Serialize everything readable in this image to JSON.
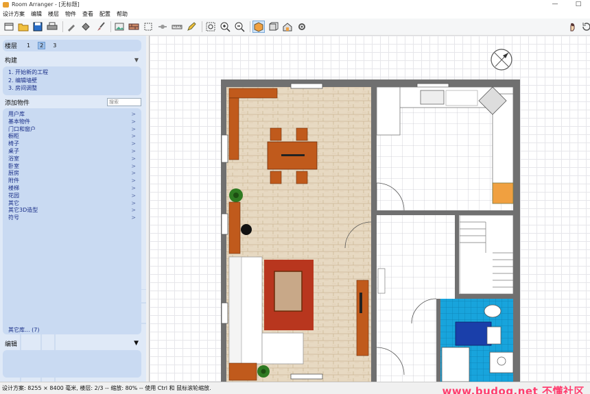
{
  "window": {
    "title": "Room Arranger - [无标题]",
    "minimize": "—",
    "maximize": "□"
  },
  "menu": [
    "设计方案",
    "编辑",
    "楼层",
    "物件",
    "查看",
    "配置",
    "帮助"
  ],
  "toolbar": {
    "icons": [
      "new-file-icon",
      "open-folder-icon",
      "save-icon",
      "print-icon",
      "pick-icon",
      "bucket-icon",
      "brush-icon",
      "import-image-icon",
      "brick-wall-icon",
      "measure-icon",
      "dimension-icon",
      "ruler-icon",
      "pencil-icon",
      "zoom-fit-icon",
      "zoom-in-icon",
      "zoom-out-icon",
      "view-2d-icon",
      "view-3d-box-icon",
      "view-3d-house-icon",
      "settings-icon",
      "hand-icon",
      "rotate-icon"
    ]
  },
  "floors": {
    "label": "楼层",
    "items": [
      "1",
      "2",
      "3"
    ],
    "selected": "2"
  },
  "build": {
    "title": "构建",
    "steps": [
      "1.  开始新的工程",
      "2.  编辑墙壁",
      "3.  房间调整"
    ]
  },
  "add_objects": {
    "title": "添加物件",
    "search_placeholder": "搜索",
    "categories": [
      "用户库",
      "基本物件",
      "门口和窗户",
      "橱柜",
      "椅子",
      "桌子",
      "浴室",
      "卧室",
      "厨房",
      "附件",
      "楼梯",
      "花园",
      "其它",
      "其它3D造型",
      "符号"
    ],
    "more_libraries": "其它库...  (7)"
  },
  "edit": {
    "title": "编辑"
  },
  "status": "设计方案: 8255 × 8400 毫米, 楼层: 2/3 -- 缩放: 80% -- 使用 Ctrl 和 鼠标滚轮缩放.",
  "watermark": "www.budog.net 不懂社区",
  "colors": {
    "panel": "#dfe9f7",
    "panel_box": "#c9daf2",
    "wall": "#6a6a6a",
    "wood_floor": "#e7d9c2",
    "furniture_brown": "#c05a1c",
    "carpet_red": "#b8361e",
    "bath_tile": "#18a4dc",
    "kitchen_orange": "#f0a040"
  }
}
